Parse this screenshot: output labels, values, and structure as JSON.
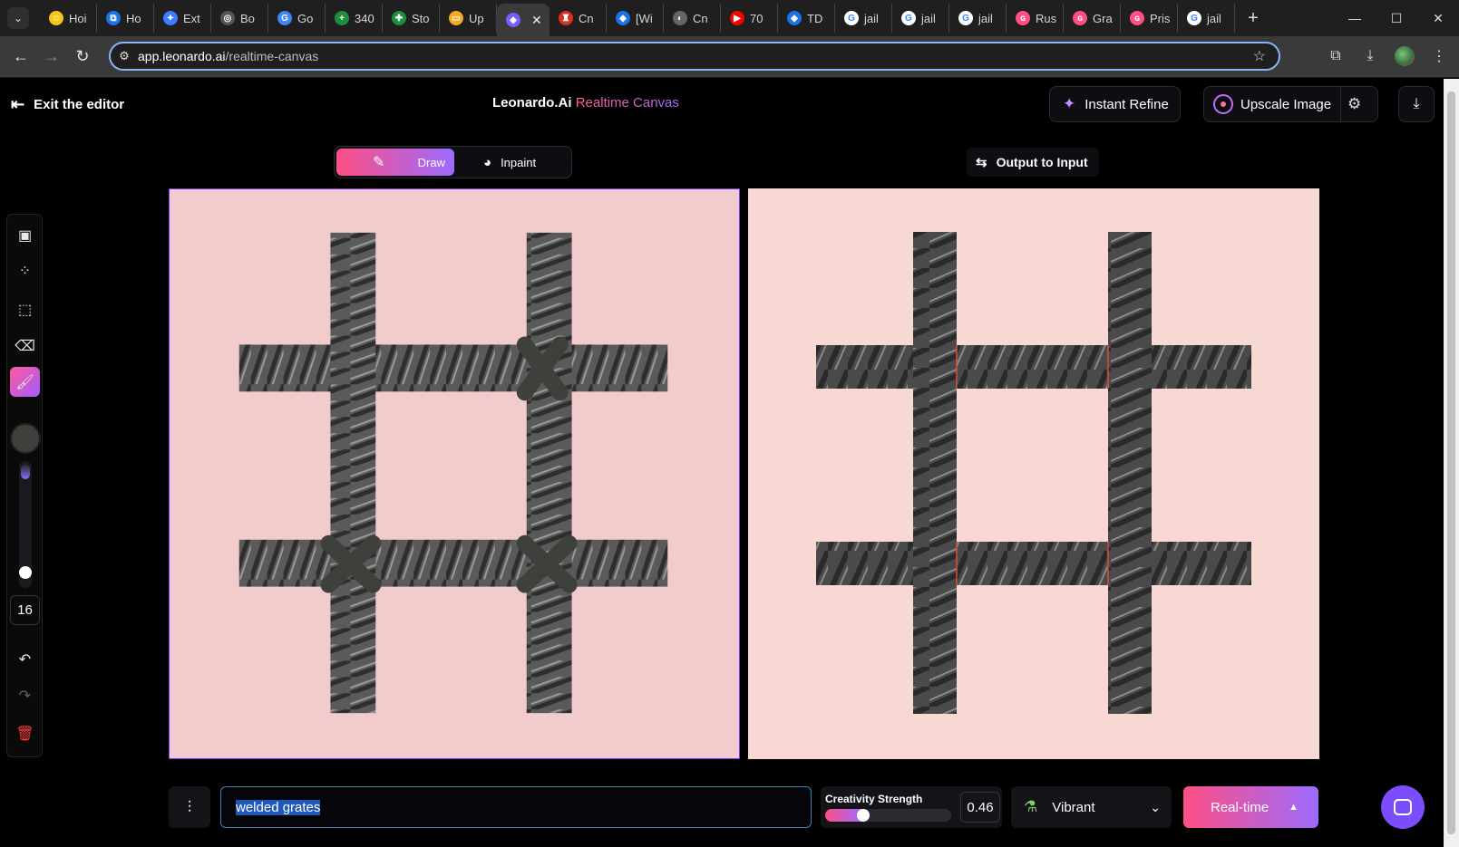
{
  "browser": {
    "tabs": [
      {
        "label": "Hoi",
        "color": "#f5c518",
        "glyph": "☺"
      },
      {
        "label": "Ho",
        "color": "#1a73e8",
        "glyph": "⧉"
      },
      {
        "label": "Ext",
        "color": "#3c7bff",
        "glyph": "✦"
      },
      {
        "label": "Bo",
        "color": "#555",
        "glyph": "◎"
      },
      {
        "label": "Go",
        "color": "#4285f4",
        "glyph": "G"
      },
      {
        "label": "340",
        "color": "#1e8e3e",
        "glyph": "+"
      },
      {
        "label": "Sto",
        "color": "#1e8e3e",
        "glyph": "✚"
      },
      {
        "label": "Up",
        "color": "#f9a825",
        "glyph": "▭"
      },
      {
        "label": "",
        "color": "#7b5cff",
        "glyph": "◈",
        "active": true
      },
      {
        "label": "Cn",
        "color": "#d93025",
        "glyph": "♜"
      },
      {
        "label": "[Wi",
        "color": "#1a73e8",
        "glyph": "◆"
      },
      {
        "label": "Cn",
        "color": "#666",
        "glyph": "◐"
      },
      {
        "label": "70",
        "color": "#ff0000",
        "glyph": "▶"
      },
      {
        "label": "TD",
        "color": "#1a73e8",
        "glyph": "◆"
      },
      {
        "label": "jail",
        "color": "#ffffff",
        "glyph": "G"
      },
      {
        "label": "jail",
        "color": "#ffffff",
        "glyph": "G"
      },
      {
        "label": "jail",
        "color": "#ffffff",
        "glyph": "G"
      },
      {
        "label": "Rus",
        "color": "#ff4f84",
        "glyph": "ɢ"
      },
      {
        "label": "Gra",
        "color": "#ff4f84",
        "glyph": "ɢ"
      },
      {
        "label": "Pris",
        "color": "#ff4f84",
        "glyph": "ɢ"
      },
      {
        "label": "jail",
        "color": "#ffffff",
        "glyph": "G"
      }
    ],
    "url_host": "app.leonardo.ai",
    "url_path": "/realtime-canvas"
  },
  "header": {
    "exit_label": "Exit the editor",
    "brand": "Leonardo.Ai",
    "brand_accent": "Realtime Canvas",
    "instant_refine": "Instant Refine",
    "upscale_image": "Upscale Image"
  },
  "modes": {
    "draw": "Draw",
    "inpaint": "Inpaint",
    "active": "Draw"
  },
  "output_to_input": "Output to Input",
  "tools": {
    "brush_size": "16",
    "brush_size_fraction": 0.08,
    "brush_color": "#3e403c",
    "items": [
      "image-upload-icon",
      "grid-select-icon",
      "select-cursor-icon",
      "eraser-icon",
      "brush-icon",
      "undo-icon",
      "redo-icon",
      "trash-icon"
    ]
  },
  "bottom": {
    "prompt": "welded grates",
    "creativity_label": "Creativity Strength",
    "creativity_value": "0.46",
    "creativity_fraction": 0.46,
    "style": "Vibrant",
    "generate": "Real-time"
  },
  "colors": {
    "accent_start": "#ff4f84",
    "accent_end": "#9c6bff",
    "left_canvas_bg": "#f2cccc",
    "right_canvas_bg": "#f8d8d2",
    "bar_steel": "#555555"
  }
}
